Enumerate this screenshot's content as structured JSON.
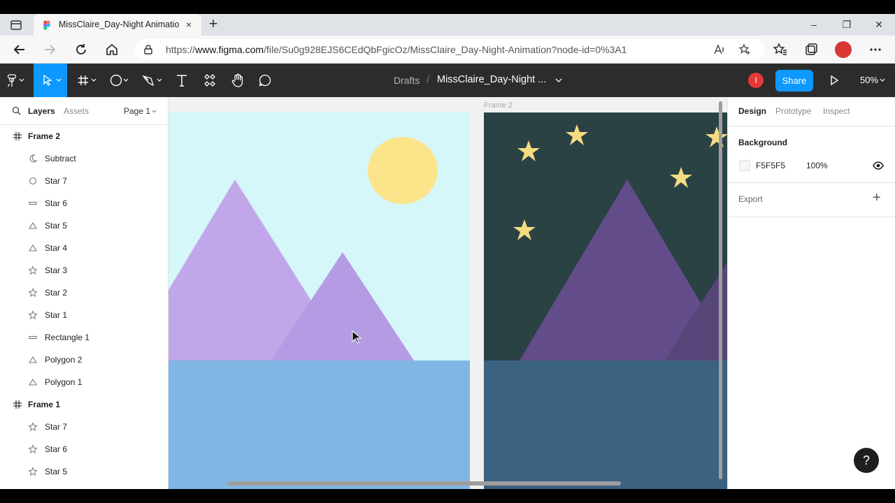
{
  "browser": {
    "tab_title": "MissClaire_Day-Night Animation",
    "tab_close": "×",
    "new_tab": "+",
    "url_prefix": "https://",
    "url_host": "www.figma.com",
    "url_path": "/file/Su0g928EJS6CEdQbFgicOz/MissClaire_Day-Night-Animation?node-id=0%3A1",
    "window_controls": [
      "–",
      "❐",
      "✕"
    ]
  },
  "toolbar": {
    "tools": [
      "figma-menu-icon",
      "move-icon",
      "frame-icon",
      "ellipse-icon",
      "pen-icon",
      "text-icon",
      "components-icon",
      "hand-icon",
      "comment-icon"
    ],
    "active_tool": "move-icon",
    "breadcrumb_drafts": "Drafts",
    "breadcrumb_sep": "/",
    "file_name": "MissClaire_Day-Night ...",
    "user_initial": "I",
    "share_label": "Share",
    "zoom": "50%"
  },
  "left_panel": {
    "tabs": {
      "layers": "Layers",
      "assets": "Assets"
    },
    "page": "Page 1",
    "layers": [
      {
        "label": "Frame 2",
        "icon": "frame-icon",
        "frame": true
      },
      {
        "label": "Subtract",
        "icon": "moon-icon",
        "frame": false
      },
      {
        "label": "Star 7",
        "icon": "ellipse-icon",
        "frame": false
      },
      {
        "label": "Star 6",
        "icon": "rectangle-icon",
        "frame": false
      },
      {
        "label": "Star 5",
        "icon": "triangle-icon",
        "frame": false
      },
      {
        "label": "Star 4",
        "icon": "triangle-icon",
        "frame": false
      },
      {
        "label": "Star 3",
        "icon": "star-icon",
        "frame": false
      },
      {
        "label": "Star 2",
        "icon": "star-icon",
        "frame": false
      },
      {
        "label": "Star 1",
        "icon": "star-icon",
        "frame": false
      },
      {
        "label": "Rectangle 1",
        "icon": "rectangle-icon",
        "frame": false
      },
      {
        "label": "Polygon 2",
        "icon": "triangle-icon",
        "frame": false
      },
      {
        "label": "Polygon 1",
        "icon": "triangle-icon",
        "frame": false
      },
      {
        "label": "Frame 1",
        "icon": "frame-icon",
        "frame": true
      },
      {
        "label": "Star 7",
        "icon": "star-icon",
        "frame": false
      },
      {
        "label": "Star 6",
        "icon": "star-icon",
        "frame": false
      },
      {
        "label": "Star 5",
        "icon": "star-icon",
        "frame": false
      }
    ]
  },
  "canvas": {
    "frame_label": "Frame 2",
    "colors": {
      "day_sky": "#d5f7f9",
      "sun": "#fbe48a",
      "day_mountain_back": "#c1a7ea",
      "day_mountain_front": "#b49be3",
      "day_water": "#80b6e3",
      "night_sky": "#2b4245",
      "night_mountain_back": "#624c8a",
      "night_mountain_front": "#57467a",
      "night_water": "#3c6282",
      "star": "#f6dc80"
    }
  },
  "right_panel": {
    "tabs": {
      "design": "Design",
      "prototype": "Prototype",
      "inspect": "Inspect"
    },
    "background_title": "Background",
    "background_hex": "F5F5F5",
    "background_opacity": "100%",
    "export_label": "Export",
    "export_plus": "+",
    "help": "?"
  }
}
